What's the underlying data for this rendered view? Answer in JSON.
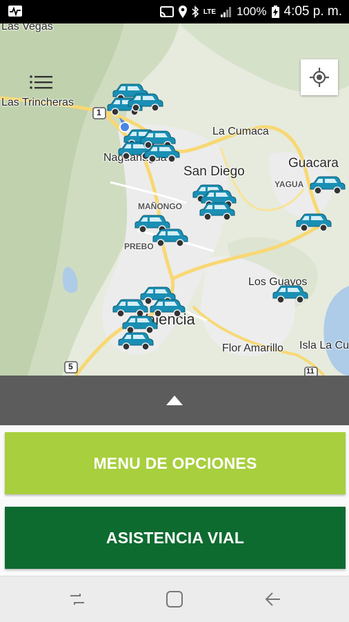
{
  "status_bar": {
    "network": "LTE",
    "battery": "100%",
    "time": "4:05 p. m."
  },
  "map": {
    "labels": {
      "las_vegas": "Las Vegas",
      "las_trincheras": "Las Trincheras",
      "la_cumaca": "La Cumaca",
      "naguanagua": "Naguanagua",
      "san_diego": "San Diego",
      "guacara": "Guacara",
      "yagua": "YAGUA",
      "manongo": "MAÑONGO",
      "prebo": "PREBO",
      "los_guayos": "Los Guayos",
      "valencia": "Valencia",
      "flor_amarillo": "Flor Amarillo",
      "isla_la_cu": "Isla La Cu",
      "route_1": "1",
      "route_5": "5",
      "route_11": "11"
    },
    "vehicle_icon": "car-icon",
    "vehicle_color": "#1a8fb4"
  },
  "icons": {
    "menu": "menu-icon",
    "location": "my-location-icon",
    "expand": "chevron-up-icon"
  },
  "buttons": {
    "menu_opciones": "MENU DE OPCIONES",
    "asistencia_vial": "ASISTENCIA VIAL"
  },
  "colors": {
    "menu_button": "#a8cf3e",
    "asistencia_button": "#0e6b30",
    "drag_bar": "#5c5c5c"
  }
}
